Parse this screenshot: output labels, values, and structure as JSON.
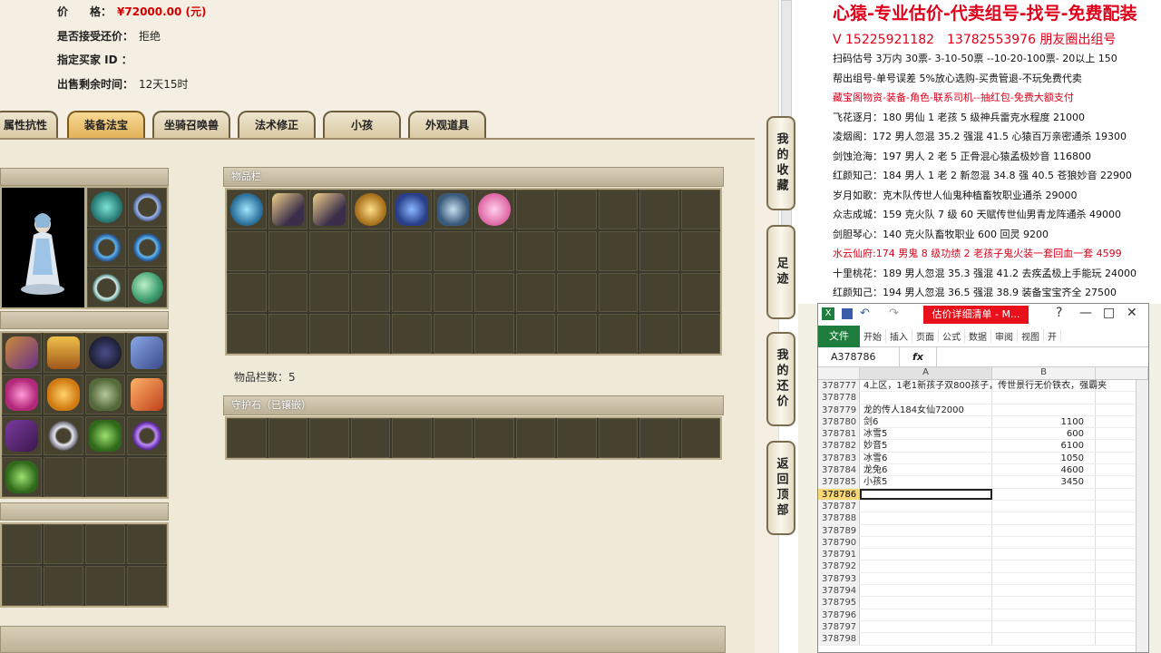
{
  "listing": {
    "price_label": "价　　格：",
    "price_value": "¥72000.00 (元)",
    "counter_offer_label": "是否接受还价：",
    "counter_offer_value": "拒绝",
    "buyer_label": "指定买家 ID ：",
    "time_label": "出售剩余时间：",
    "time_value": "12天15时"
  },
  "tabs": [
    {
      "label": "属性抗性"
    },
    {
      "label": "装备法宝"
    },
    {
      "label": "坐骑召唤兽"
    },
    {
      "label": "法术修正"
    },
    {
      "label": "小孩"
    },
    {
      "label": "外观道具"
    }
  ],
  "inventory": {
    "header": "物品栏",
    "count_text": "物品栏数：5"
  },
  "guard_stone": {
    "header": "守护石（已镶嵌）"
  },
  "side_nav": [
    {
      "label": "我的收藏"
    },
    {
      "label": "足迹"
    },
    {
      "label": "我的还价"
    },
    {
      "label": "返回顶部"
    }
  ],
  "ad": {
    "headline": "心猿-专业估价-代卖组号-找号-免费配装",
    "contact": "V 15225921182　13782553976 朋友圈出组号",
    "lines": [
      {
        "text": "扫码估号 3万内 30票- 3-10-50票 --10-20-100票- 20以上 150",
        "red": false
      },
      {
        "text": "帮出组号-单号误差 5%放心选购-买贵管退-不玩免费代卖",
        "red": false
      },
      {
        "text": "藏宝阁物资-装备-角色-联系司机--抽红包-免费大额支付",
        "red": true
      },
      {
        "text": "飞花逐月：180 男仙 1 老孩 5 级神兵雷克水程度 21000",
        "red": false
      },
      {
        "text": "凌烟阁：172 男人忽混 35.2 强混 41.5 心猿百万亲密通杀 19300",
        "red": false
      },
      {
        "text": "剑蚀沧海：197 男人 2 老 5 正骨混心猿孟极妙音 116800",
        "red": false
      },
      {
        "text": "红颜知己：184 男人 1 老 2 新忽混 34.8 强 40.5 苍狼妙音 22900",
        "red": false
      },
      {
        "text": "岁月如歌：克木队传世人仙鬼种植畜牧职业通杀 29000",
        "red": false
      },
      {
        "text": "众志成城：159 克火队 7 级 60 天赋传世仙男青龙阵通杀 49000",
        "red": false
      },
      {
        "text": "剑胆琴心：140 克火队畜牧职业 600 回灵 9200",
        "red": false
      },
      {
        "text": "水云仙府:174 男鬼 8 级功绩 2 老孩子鬼火装一套回血一套 4599",
        "red": true
      },
      {
        "text": "十里桃花：189 男人忽混 35.3 强混 41.2 去疾孟极上手能玩 24000",
        "red": false
      },
      {
        "text": "红颜知己：194 男人忽混 36.5 强混 38.9 装备宝宝齐全 27500",
        "red": false
      }
    ]
  },
  "excel": {
    "title": "估价详细清单 - M...",
    "ribbon_file": "文件",
    "ribbon_tabs": [
      "开始",
      "插入",
      "页面",
      "公式",
      "数据",
      "审阅",
      "视图",
      "开"
    ],
    "name_box": "A378786",
    "fx": "fx",
    "col_a": "A",
    "col_b": "B",
    "rows": [
      {
        "n": "378777",
        "a": "4上区，1老1新孩子双800孩子，传世景行无价铁衣，强霸夹",
        "b": ""
      },
      {
        "n": "378778",
        "a": "",
        "b": ""
      },
      {
        "n": "378779",
        "a": "龙的传人184女仙72000",
        "b": ""
      },
      {
        "n": "378780",
        "a": "剑6",
        "b": "1100"
      },
      {
        "n": "378781",
        "a": "冰雪5",
        "b": "600"
      },
      {
        "n": "378782",
        "a": "妙音5",
        "b": "6100"
      },
      {
        "n": "378783",
        "a": "冰雪6",
        "b": "1050"
      },
      {
        "n": "378784",
        "a": "龙兔6",
        "b": "4600"
      },
      {
        "n": "378785",
        "a": "小孩5",
        "b": "3450"
      },
      {
        "n": "378786",
        "a": "",
        "b": ""
      },
      {
        "n": "378787",
        "a": "",
        "b": ""
      },
      {
        "n": "378788",
        "a": "",
        "b": ""
      },
      {
        "n": "378789",
        "a": "",
        "b": ""
      },
      {
        "n": "378790",
        "a": "",
        "b": ""
      },
      {
        "n": "378791",
        "a": "",
        "b": ""
      },
      {
        "n": "378792",
        "a": "",
        "b": ""
      },
      {
        "n": "378793",
        "a": "",
        "b": ""
      },
      {
        "n": "378794",
        "a": "",
        "b": ""
      },
      {
        "n": "378795",
        "a": "",
        "b": ""
      },
      {
        "n": "378796",
        "a": "",
        "b": ""
      },
      {
        "n": "378797",
        "a": "",
        "b": ""
      },
      {
        "n": "378798",
        "a": "",
        "b": ""
      }
    ]
  },
  "colors": {
    "price_red": "#d40000",
    "ad_red": "#e0001a",
    "excel_green": "#1e7d3c",
    "excel_title_red": "#e8101a"
  }
}
